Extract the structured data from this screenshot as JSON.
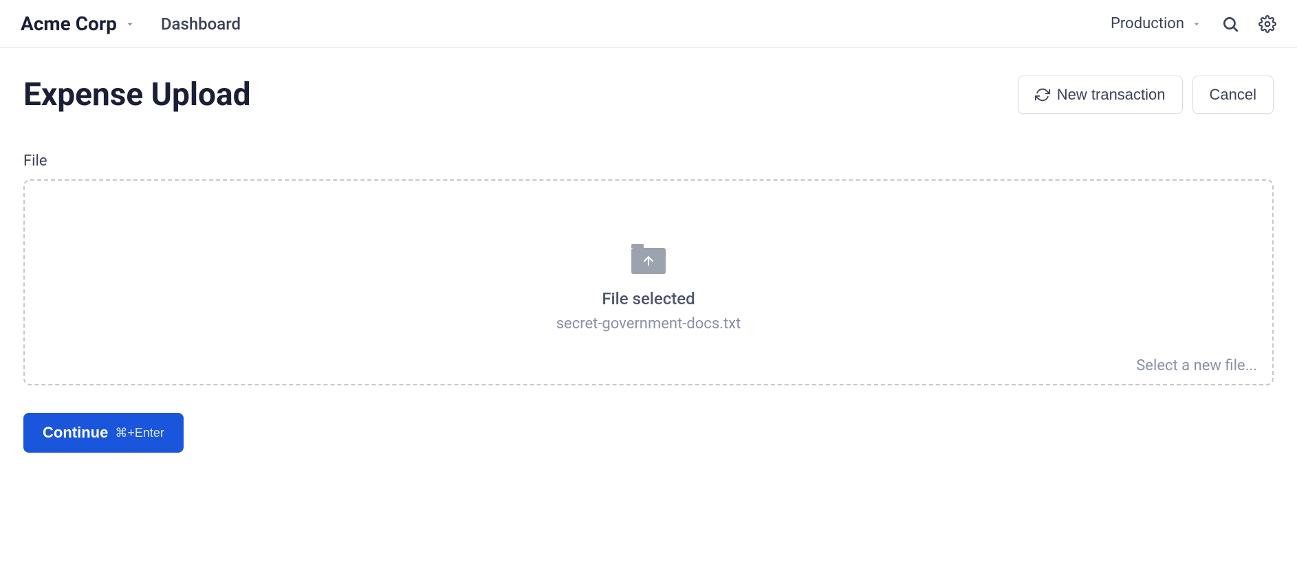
{
  "header": {
    "org_name": "Acme Corp",
    "nav_dashboard": "Dashboard",
    "environment": "Production"
  },
  "page": {
    "title": "Expense Upload",
    "new_transaction_label": "New transaction",
    "cancel_label": "Cancel"
  },
  "upload": {
    "field_label": "File",
    "status_label": "File selected",
    "file_name": "secret-government-docs.txt",
    "select_new_label": "Select a new file..."
  },
  "actions": {
    "continue_label": "Continue",
    "continue_shortcut": "⌘+Enter"
  }
}
